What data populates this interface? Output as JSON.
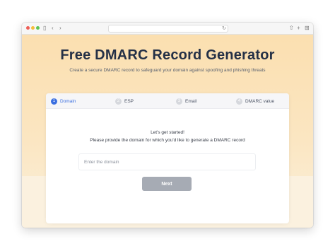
{
  "browser": {
    "icons": {
      "sidebar": "sidebar-icon",
      "back": "chevron-left-icon",
      "forward": "chevron-right-icon",
      "reload": "reload-icon",
      "share": "share-icon",
      "new_tab": "plus-icon",
      "tabs": "tabs-overview-icon"
    }
  },
  "page": {
    "title": "Free DMARC Record Generator",
    "subtitle": "Create a secure DMARC record to safeguard your domain against spoofing and phishing threats"
  },
  "steps": [
    {
      "number": "1",
      "label": "Domain",
      "active": true
    },
    {
      "number": "2",
      "label": "ESP",
      "active": false
    },
    {
      "number": "3",
      "label": "Email",
      "active": false
    },
    {
      "number": "4",
      "label": "DMARC value",
      "active": false
    }
  ],
  "form": {
    "intro_line1": "Let's get started!",
    "intro_line2": "Please provide the domain for which you'd like to generate a DMARC record",
    "domain_placeholder": "Enter the domain",
    "domain_value": "",
    "next_label": "Next"
  },
  "colors": {
    "accent": "#3b6fe0",
    "title": "#243046",
    "button_disabled": "#a6abb4",
    "background": "#fbdfb0"
  }
}
